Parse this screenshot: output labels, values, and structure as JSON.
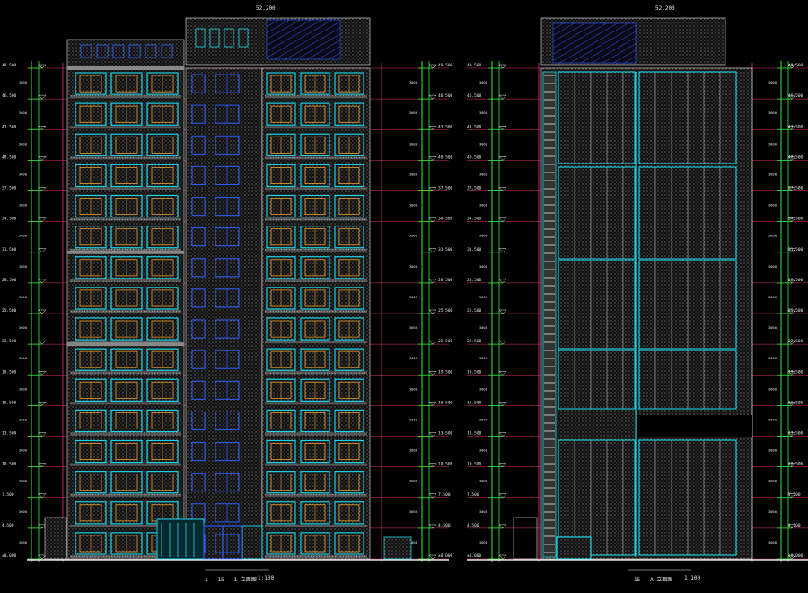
{
  "colors": {
    "background": "#000000",
    "grid_line": "#e0307a",
    "level_green": "#33ee33",
    "window_cyan": "#19d3e6",
    "window_blue": "#2a5cff",
    "frame_orange": "#f0a030",
    "hatch_gray": "#7a7a7a",
    "text": "#e8e8e8"
  },
  "drawing_left": {
    "title": "1 - 15 - 1 立面图",
    "scale": "1:100",
    "roof_level": "52.200",
    "parapet_level": "49.500",
    "floor_count": 16
  },
  "drawing_right": {
    "title": "15 - A 立面图",
    "scale": "1:100",
    "roof_level": "52.200",
    "parapet_level": "49.500",
    "floor_count": 16
  },
  "level_labels": [
    "49.500",
    "46.500",
    "43.500",
    "40.500",
    "37.500",
    "34.500",
    "31.500",
    "28.500",
    "25.500",
    "22.500",
    "19.500",
    "16.500",
    "13.500",
    "10.500",
    "7.500",
    "4.500",
    "±0.000"
  ],
  "dimension_label": "3000",
  "ground_label": "-0.300",
  "icons": {
    "level_marker": "triangle-level-icon",
    "north_tick": "axis-tick-icon"
  }
}
